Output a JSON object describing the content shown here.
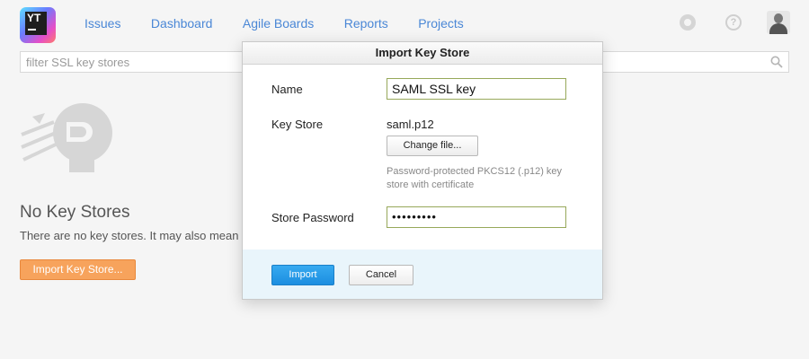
{
  "app": {
    "logo_text": "YT"
  },
  "nav": {
    "items": [
      {
        "label": "Issues"
      },
      {
        "label": "Dashboard"
      },
      {
        "label": "Agile Boards"
      },
      {
        "label": "Reports"
      },
      {
        "label": "Projects"
      }
    ],
    "link_color": "#4a87d6"
  },
  "toolbar_icons": {
    "settings": "gear-icon",
    "help": "help-icon",
    "help_glyph": "?",
    "user": "avatar"
  },
  "filter": {
    "placeholder": "filter SSL key stores",
    "value": "",
    "icon": "search-icon"
  },
  "empty_state": {
    "icon": "key-store-illustration",
    "title": "No Key Stores",
    "text": "There are no key stores. It may also mean t",
    "button_label": "Import Key Store...",
    "button_color": "#f7a35c"
  },
  "dialog": {
    "title": "Import Key Store",
    "name_label": "Name",
    "name_value": "SAML SSL key",
    "keystore_label": "Key Store",
    "keystore_file": "saml.p12",
    "change_file_label": "Change file...",
    "keystore_hint": "Password-protected PKCS12 (.p12) key store with certificate",
    "password_label": "Store Password",
    "password_value": "•••••••••",
    "import_label": "Import",
    "cancel_label": "Cancel",
    "primary_color": "#1c8ee0",
    "footer_color": "#e9f5fb"
  }
}
